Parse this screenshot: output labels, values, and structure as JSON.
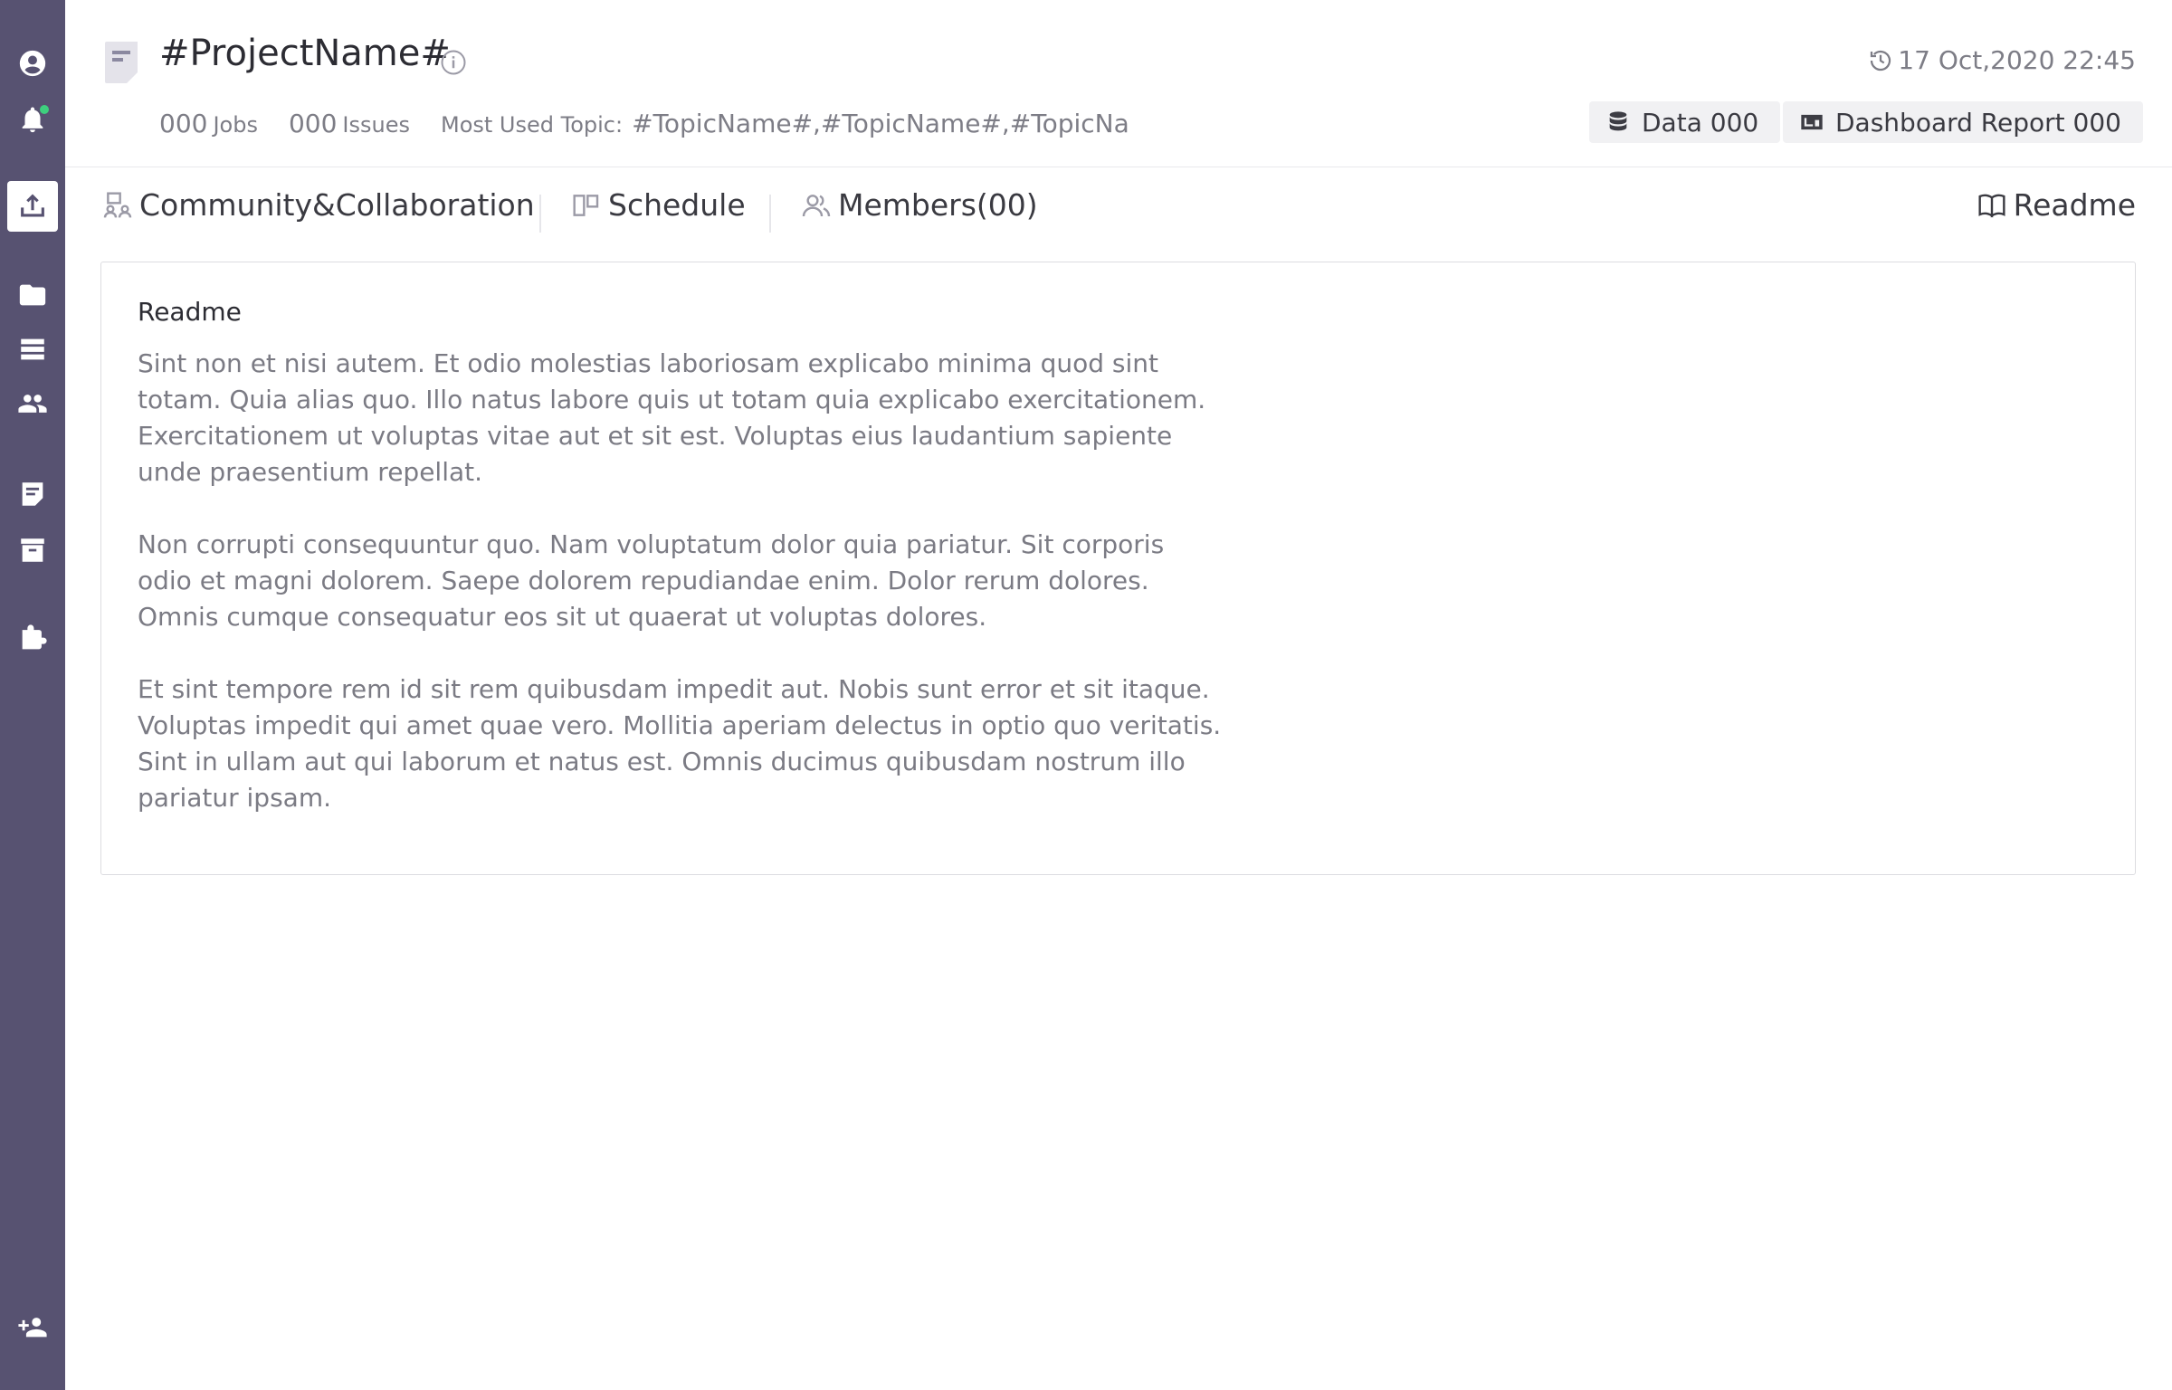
{
  "sidebar": {
    "items": [
      {
        "icon": "account-icon"
      },
      {
        "icon": "bell-icon"
      },
      {
        "icon": "upload-icon"
      },
      {
        "icon": "folder-icon"
      },
      {
        "icon": "storage-icon"
      },
      {
        "icon": "people-icon"
      },
      {
        "icon": "note-icon"
      },
      {
        "icon": "archive-icon"
      },
      {
        "icon": "extension-icon"
      },
      {
        "icon": "add-user-icon"
      }
    ]
  },
  "header": {
    "title": "#ProjectName#",
    "timestamp": "17 Oct,2020 22:45",
    "jobs_count": "000",
    "jobs_label": "Jobs",
    "issues_count": "000",
    "issues_label": "Issues",
    "topic_label": "Most Used Topic:",
    "topics": "#TopicName#,#TopicName#,#TopicNa",
    "data_pill": "Data 000",
    "dashboard_pill": "Dashboard Report 000"
  },
  "tabs": {
    "community": "Community&Collaboration",
    "schedule": "Schedule",
    "members": "Members(00)",
    "readme": "Readme"
  },
  "readme": {
    "title": "Readme",
    "paragraphs": [
      "Sint non et nisi autem. Et odio molestias laboriosam explicabo minima quod sint totam. Quia alias quo. Illo natus labore quis ut totam quia explicabo exercitationem. Exercitationem ut voluptas vitae aut et sit est. Voluptas eius laudantium sapiente unde praesentium repellat.",
      "Non corrupti consequuntur quo. Nam voluptatum dolor quia pariatur. Sit corporis odio et magni dolorem. Saepe dolorem repudiandae enim. Dolor rerum dolores. Omnis cumque consequatur eos sit ut quaerat ut voluptas dolores.",
      "Et sint tempore rem id sit rem quibusdam impedit aut. Nobis sunt error et sit itaque. Voluptas impedit qui amet quae vero. Mollitia aperiam delectus in optio quo veritatis. Sint in ullam aut qui laborum et natus est. Omnis ducimus quibusdam nostrum illo pariatur ipsam."
    ]
  }
}
